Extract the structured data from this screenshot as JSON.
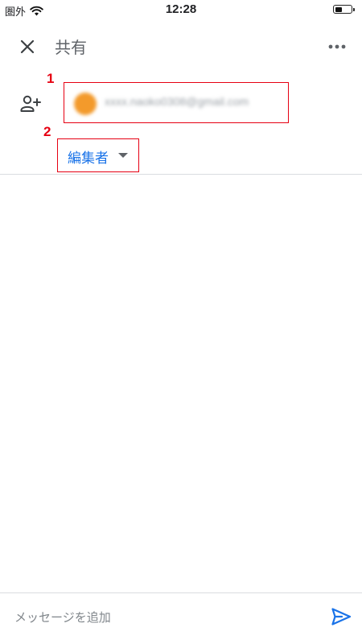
{
  "status_bar": {
    "carrier": "圏外",
    "time": "12:28",
    "battery_level": 0.45
  },
  "header": {
    "title": "共有",
    "close_icon": "close-icon",
    "more_icon": "more-horizontal-icon"
  },
  "annotations": {
    "marker_1": "1",
    "marker_2": "2",
    "color": "#e60012"
  },
  "recipient": {
    "email": "xxxx.naoko0308@gmail.com",
    "avatar_color": "#f39a2b",
    "add_person_icon": "add-person-icon"
  },
  "role": {
    "label": "編集者",
    "color": "#1a73e8"
  },
  "message": {
    "placeholder": "メッセージを追加",
    "send_icon": "send-icon",
    "send_color": "#1a73e8"
  }
}
